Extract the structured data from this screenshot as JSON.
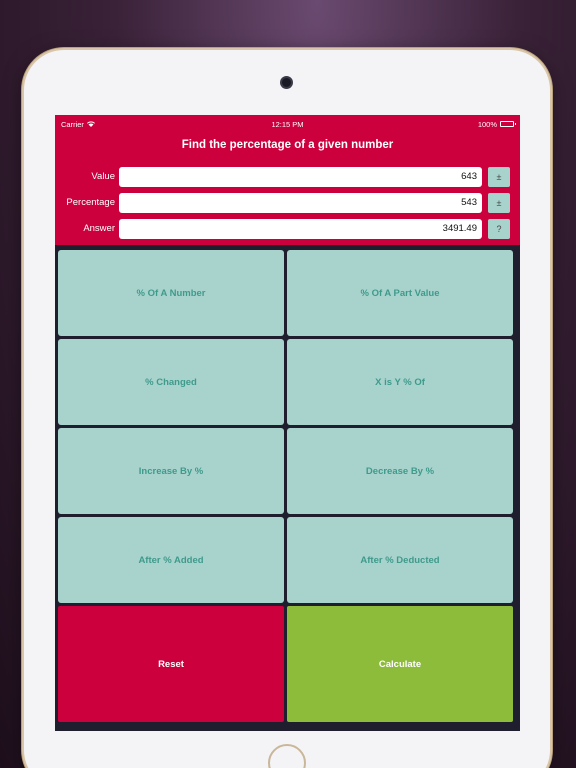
{
  "status_bar": {
    "carrier": "Carrier",
    "time": "12:15 PM",
    "battery": "100%"
  },
  "header": {
    "title": "Find the percentage of a given number"
  },
  "fields": [
    {
      "label": "Value",
      "value": "643",
      "button": "±"
    },
    {
      "label": "Percentage",
      "value": "543",
      "button": "±"
    },
    {
      "label": "Answer",
      "value": "3491.49",
      "button": "?"
    }
  ],
  "tiles": [
    "% Of A Number",
    "% Of A Part Value",
    "% Changed",
    "X is Y % Of",
    "Increase By %",
    "Decrease By %",
    "After % Added",
    "After % Deducted"
  ],
  "actions": {
    "reset": "Reset",
    "calculate": "Calculate"
  },
  "colors": {
    "accent": "#cc003d",
    "tile": "#a8d3cc",
    "tile_text": "#3f9a8c",
    "calculate": "#8dbb3a",
    "background": "#1e1e2e"
  }
}
